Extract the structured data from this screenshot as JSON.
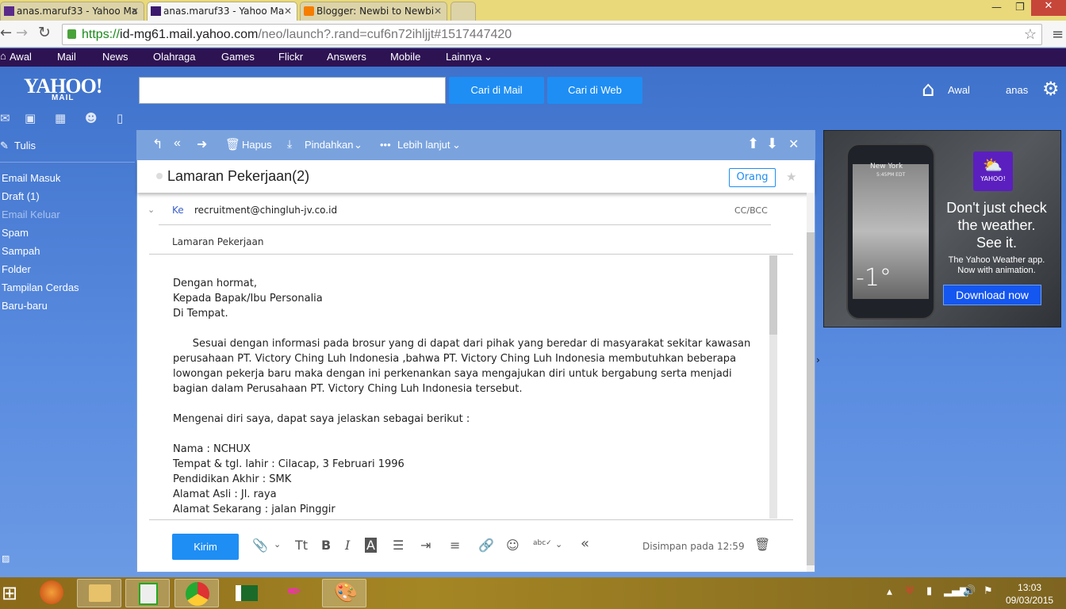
{
  "browser": {
    "tabs": [
      {
        "label": "anas.maruf33 - Yahoo Ma",
        "active": false
      },
      {
        "label": "anas.maruf33 - Yahoo Ma",
        "active": true
      },
      {
        "label": "Blogger: Newbi to Newbi",
        "active": false
      }
    ],
    "url": {
      "scheme": "https://",
      "domain": "id-mg61.mail.yahoo.com",
      "path": "/neo/launch?.rand=cuf6n72ihljjt#1517447420"
    }
  },
  "yahoo_nav": [
    "Awal",
    "Mail",
    "News",
    "Olahraga",
    "Games",
    "Flickr",
    "Answers",
    "Mobile",
    "Lainnya"
  ],
  "header": {
    "logo": "YAHOO!",
    "logo_sub": "MAIL",
    "search_value": "",
    "search_mail": "Cari di Mail",
    "search_web": "Cari di Web",
    "home": "Awal",
    "user": "anas"
  },
  "sidebar": {
    "compose": "Tulis",
    "items": [
      "Email Masuk",
      "Draft (1)",
      "Email Keluar",
      "Spam",
      "Sampah",
      "Folder",
      "Tampilan Cerdas",
      "Baru-baru"
    ]
  },
  "toolbar": {
    "delete": "Hapus",
    "move": "Pindahkan",
    "more": "Lebih lanjut"
  },
  "thread": {
    "title": "Lamaran Pekerjaan(2)",
    "people": "Orang"
  },
  "compose": {
    "to_label": "Ke",
    "to": "recruitment@chingluh-jv.co.id",
    "ccbcc": "CC/BCC",
    "subject": "Lamaran Pekerjaan",
    "body": [
      "Dengan hormat,",
      "Kepada Bapak/Ibu Personalia",
      "Di Tempat.",
      "",
      "      Sesuai dengan informasi pada brosur yang di dapat dari pihak yang beredar di masyarakat sekitar kawasan",
      "perusahaan PT. Victory Ching Luh Indonesia ,bahwa PT. Victory Ching Luh Indonesia membutuhkan beberapa",
      "lowongan pekerja baru maka dengan ini perkenankan saya mengajukan diri untuk bergabung serta menjadi",
      "bagian dalam Perusahaan PT. Victory Ching Luh Indonesia tersebut.",
      "",
      "Mengenai diri saya, dapat saya jelaskan sebagai berikut :",
      "",
      "Nama : NCHUX",
      "Tempat & tgl. lahir : Cilacap, 3 Februari 1996",
      "Pendidikan Akhir : SMK",
      "Alamat Asli : Jl. raya",
      "Alamat Sekarang : jalan Pinggir"
    ],
    "send": "Kirim",
    "saved": "Disimpan pada 12:59"
  },
  "ad": {
    "city": "New York",
    "time": "5:45PM EDT",
    "temp": "-1°",
    "brand": "YAHOO!",
    "headline": [
      "Don't just check",
      "the weather.",
      "See it."
    ],
    "sub": [
      "The Yahoo Weather app.",
      "Now with animation."
    ],
    "cta": "Download now"
  },
  "taskbar": {
    "time": "13:03",
    "date": "09/03/2015"
  },
  "colors": {
    "yahoo_nav": "#2e1353",
    "accent": "#1e8ef4",
    "toolbar": "#7aa3de"
  }
}
